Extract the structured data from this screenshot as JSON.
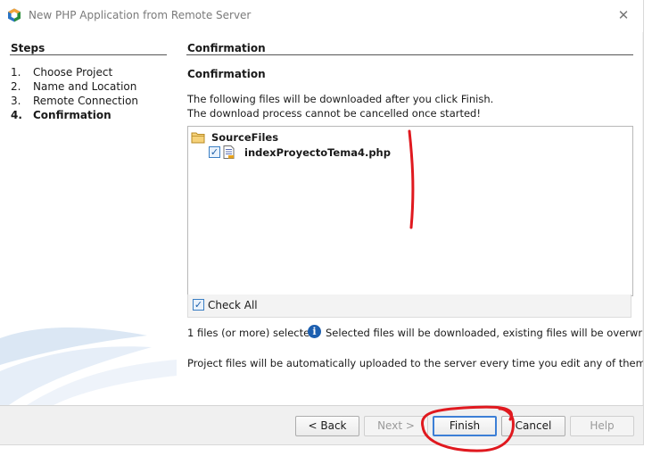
{
  "window": {
    "title": "New PHP Application from Remote Server"
  },
  "steps": {
    "heading": "Steps",
    "items": [
      {
        "num": "1.",
        "label": "Choose Project"
      },
      {
        "num": "2.",
        "label": "Name and Location"
      },
      {
        "num": "3.",
        "label": "Remote Connection"
      },
      {
        "num": "4.",
        "label": "Confirmation"
      }
    ],
    "active_index": 3
  },
  "panel": {
    "title": "Confirmation",
    "subtitle": "Confirmation",
    "info_line1": "The following files will be downloaded after you click Finish.",
    "info_line2": "The download process cannot be cancelled once started!",
    "tree": {
      "folder": {
        "icon": "folder-icon",
        "label": "SourceFiles"
      },
      "files": [
        {
          "label": "indexProyectoTema4.php",
          "checked": true,
          "icon": "php-file-icon"
        }
      ]
    },
    "check_all": {
      "label": "Check All",
      "checked": true
    },
    "selected_count": "1 files (or more) selected",
    "info_message": "Selected files will be downloaded, existing files will be overwritten",
    "upload_note": "Project files will be automatically uploaded to the server every time you edit any of them."
  },
  "buttons": {
    "back": "< Back",
    "next": "Next >",
    "finish": "Finish",
    "cancel": "Cancel",
    "help": "Help"
  },
  "colors": {
    "accent": "#3c7fd6",
    "annotation": "#e0191f"
  }
}
